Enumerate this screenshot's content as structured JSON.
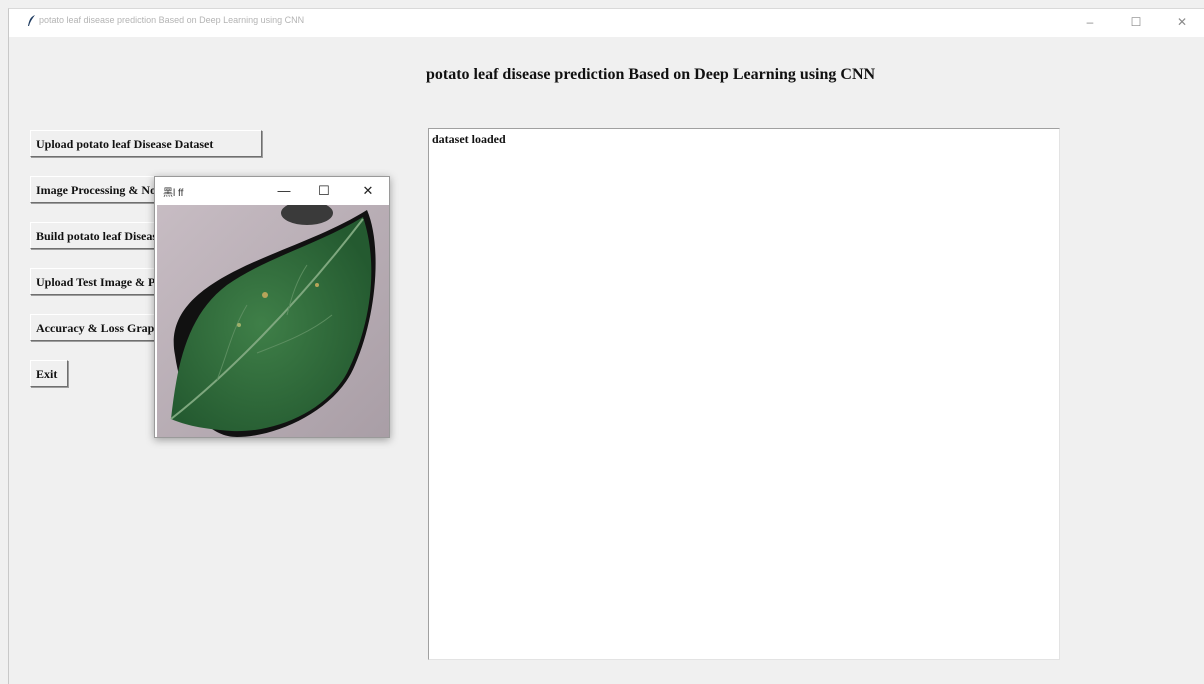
{
  "window": {
    "title": "potato leaf disease prediction Based on Deep Learning using CNN",
    "min_glyph": "–",
    "max_glyph": "☐",
    "close_glyph": "✕"
  },
  "heading": "potato leaf disease prediction Based on Deep Learning using CNN",
  "buttons": {
    "upload_dataset": "Upload potato leaf Disease Dataset",
    "image_processing": "Image Processing & Normalization",
    "build_model": "Build potato leaf Disease Detection Model",
    "upload_test": "Upload Test Image & Predict Disease",
    "accuracy_graph": "Accuracy & Loss Graph",
    "exit": "Exit"
  },
  "output": {
    "text": "dataset loaded"
  },
  "popup": {
    "title": "黑l ff",
    "min_glyph": "—",
    "max_glyph": "☐",
    "close_glyph": "✕",
    "image_icon": "potato-leaf-image"
  },
  "colors": {
    "background": "#f0f0f0",
    "leaf": "#2f6b3a",
    "surface": "#b9aeb4"
  }
}
